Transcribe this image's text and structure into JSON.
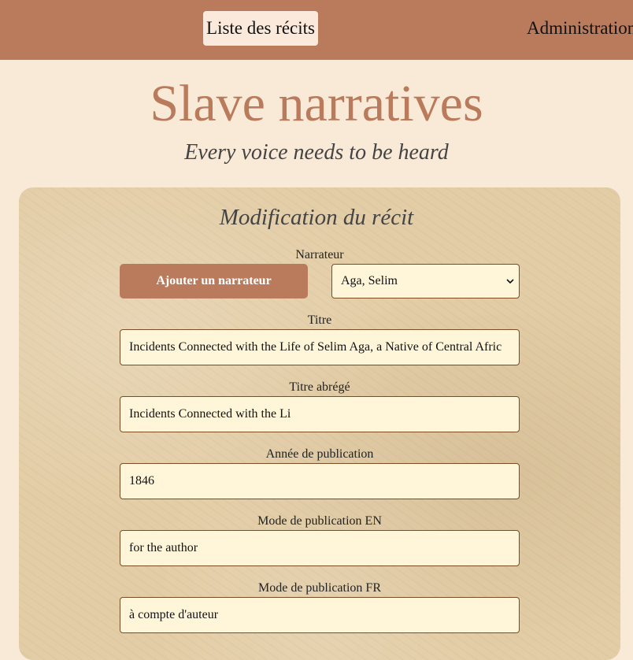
{
  "nav": {
    "list_label": "Liste des récits",
    "admin_label": "Administration"
  },
  "header": {
    "title": "Slave narratives",
    "tagline": "Every voice needs to be heard"
  },
  "form": {
    "title": "Modification du récit",
    "narrator": {
      "label": "Narrateur",
      "add_button": "Ajouter un narrateur",
      "selected": "Aga, Selim"
    },
    "title_field": {
      "label": "Titre",
      "value": "Incidents Connected  with the Life of Selim Aga, a Native of Central Afric"
    },
    "short_title": {
      "label": "Titre abrégé",
      "value": "Incidents Connected  with the Li"
    },
    "year": {
      "label": "Année de publication",
      "value": "1846"
    },
    "mode_en": {
      "label": "Mode de publication EN",
      "value": "for the author"
    },
    "mode_fr": {
      "label": "Mode de publication FR",
      "value": "à compte d'auteur"
    }
  },
  "colors": {
    "brand": "#b97b5c",
    "background": "#f9e9d7",
    "field_bg": "#fff6da",
    "field_border": "#7a4d22"
  }
}
